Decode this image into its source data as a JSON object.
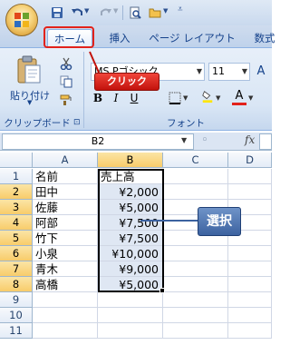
{
  "ribbon_tabs": [
    {
      "label": "ホーム",
      "active": true
    },
    {
      "label": "挿入",
      "active": false
    },
    {
      "label": "ページ レイアウト",
      "active": false
    },
    {
      "label": "数式",
      "active": false
    }
  ],
  "clipboard_group": {
    "paste_label": "貼り付け",
    "group_label": "クリップボード"
  },
  "font_group": {
    "font_name": "MS Pゴシック",
    "font_size": "11",
    "group_label": "フォント"
  },
  "annotations": {
    "click_label": "クリック",
    "select_label": "選択"
  },
  "formula_bar": {
    "name_box": "B2",
    "fx_label": "fx"
  },
  "sheet": {
    "column_headers": [
      "A",
      "B",
      "C",
      "D"
    ],
    "selected_column": "B",
    "rows": [
      {
        "row": "1",
        "a": "名前",
        "b": "売上高"
      },
      {
        "row": "2",
        "a": "田中",
        "b": "¥2,000"
      },
      {
        "row": "3",
        "a": "佐藤",
        "b": "¥5,000"
      },
      {
        "row": "4",
        "a": "阿部",
        "b": "¥7,500"
      },
      {
        "row": "5",
        "a": "竹下",
        "b": "¥7,500"
      },
      {
        "row": "6",
        "a": "小泉",
        "b": "¥10,000"
      },
      {
        "row": "7",
        "a": "青木",
        "b": "¥9,000"
      },
      {
        "row": "8",
        "a": "高橋",
        "b": "¥5,000"
      },
      {
        "row": "9",
        "a": "",
        "b": ""
      },
      {
        "row": "10",
        "a": "",
        "b": ""
      },
      {
        "row": "11",
        "a": "",
        "b": ""
      }
    ]
  },
  "colors": {
    "accent_red": "#e2221b",
    "callout_blue": "#3c62a0",
    "ribbon_blue": "#15428b"
  }
}
